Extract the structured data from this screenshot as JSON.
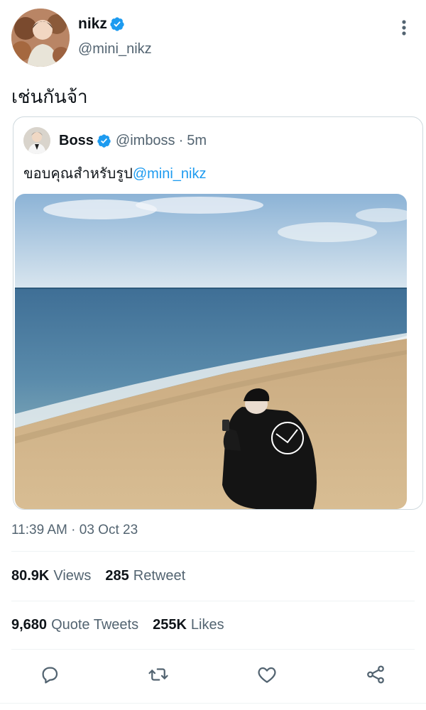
{
  "tweet": {
    "display_name": "nikz",
    "handle": "@mini_nikz",
    "text": "เช่นกันจ้า",
    "timestamp": "11:39 AM · 03 Oct 23",
    "verified": true,
    "more_icon": "more-vertical-icon"
  },
  "quote": {
    "display_name": "Boss",
    "handle": "@imboss",
    "separator": "·",
    "time": "5m",
    "text": "ขอบคุณสำหรับรูป",
    "mention": "@mini_nikz",
    "verified": true
  },
  "stats": {
    "views_count": "80.9K",
    "views_label": "Views",
    "retweets_count": "285",
    "retweets_label": "Retweet",
    "quotes_count": "9,680",
    "quotes_label": "Quote Tweets",
    "likes_count": "255K",
    "likes_label": "Likes"
  },
  "actions": [
    "reply-icon",
    "retweet-icon",
    "like-icon",
    "share-icon"
  ],
  "colors": {
    "accent": "#1d9bf0",
    "secondary_text": "#536471",
    "primary_text": "#0f1419",
    "border": "#cfd9de"
  }
}
